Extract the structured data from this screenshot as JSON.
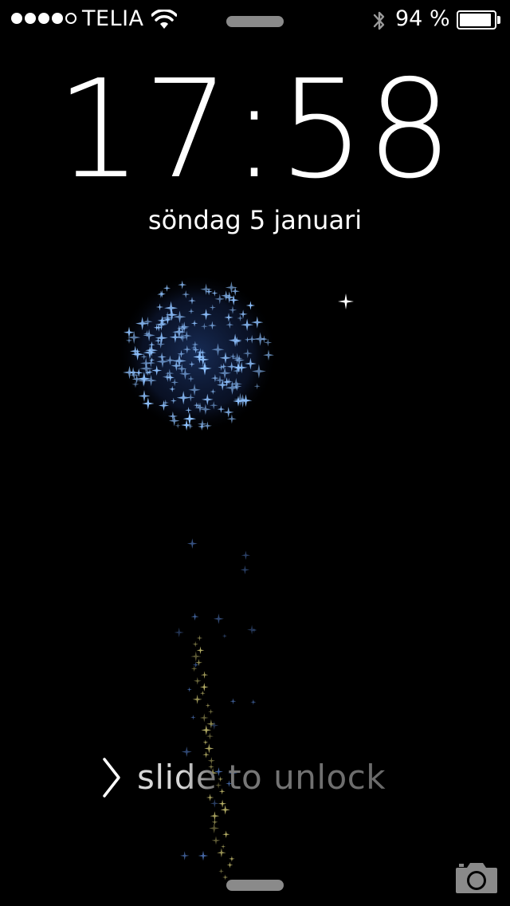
{
  "status_bar": {
    "signal_bars_filled": 4,
    "signal_bars_total": 5,
    "carrier": "TELIA",
    "battery_text": "94 %",
    "battery_level_percent": 94
  },
  "lock_screen": {
    "time": "17:58",
    "date": "söndag 5 januari",
    "slide_text": "slide to unlock"
  },
  "icons": {
    "wifi": "wifi-icon",
    "bluetooth": "bluetooth-icon",
    "battery": "battery-icon",
    "chevron": "chevron-right-icon",
    "camera": "camera-icon"
  },
  "colors": {
    "background": "#000000",
    "text": "#ffffff",
    "handle": "#8a8a8a",
    "firework_blue": "#5aa0ff",
    "firework_gold": "#c8c070"
  }
}
